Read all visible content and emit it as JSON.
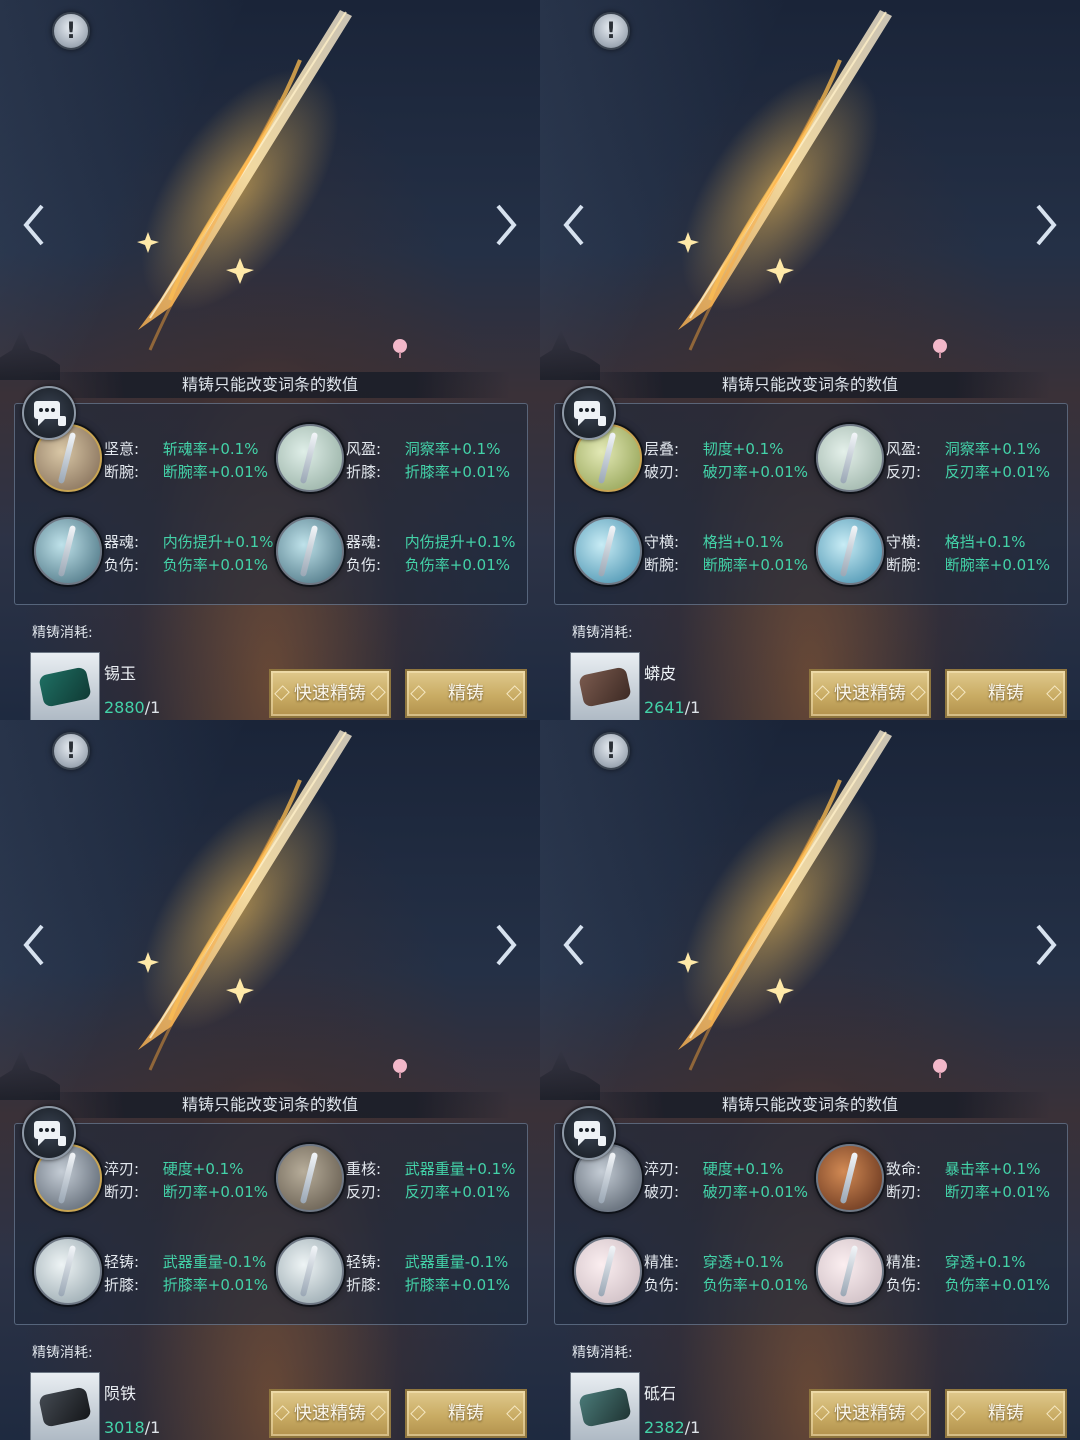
{
  "colors": {
    "value_text": "#43d2a8",
    "button_gold": "#c9ac64"
  },
  "icons": [
    "warning-icon",
    "chevron-left-icon",
    "chevron-right-icon",
    "chat-icon",
    "sword-icon"
  ],
  "panels": [
    {
      "notice": "精铸只能改变词条的数值",
      "slots": [
        {
          "lines": [
            {
              "label": "坚意:",
              "value": "斩魂率+0.1%"
            },
            {
              "label": "断腕:",
              "value": "断腕率+0.01%"
            }
          ]
        },
        {
          "lines": [
            {
              "label": "风盈:",
              "value": "洞察率+0.1%"
            },
            {
              "label": "折膝:",
              "value": "折膝率+0.01%"
            }
          ]
        },
        {
          "lines": [
            {
              "label": "器魂:",
              "value": "内伤提升+0.1%"
            },
            {
              "label": "负伤:",
              "value": "负伤率+0.01%"
            }
          ]
        },
        {
          "lines": [
            {
              "label": "器魂:",
              "value": "内伤提升+0.1%"
            },
            {
              "label": "负伤:",
              "value": "负伤率+0.01%"
            }
          ]
        }
      ],
      "cost": {
        "title": "精铸消耗:",
        "material": "锡玉",
        "have": "2880",
        "need": "/1"
      },
      "buttons": {
        "quick": "快速精铸",
        "refine": "精铸"
      }
    },
    {
      "notice": "精铸只能改变词条的数值",
      "slots": [
        {
          "lines": [
            {
              "label": "层叠:",
              "value": "韧度+0.1%"
            },
            {
              "label": "破刃:",
              "value": "破刃率+0.01%"
            }
          ]
        },
        {
          "lines": [
            {
              "label": "风盈:",
              "value": "洞察率+0.1%"
            },
            {
              "label": "反刃:",
              "value": "反刃率+0.01%"
            }
          ]
        },
        {
          "lines": [
            {
              "label": "守横:",
              "value": "格挡+0.1%"
            },
            {
              "label": "断腕:",
              "value": "断腕率+0.01%"
            }
          ]
        },
        {
          "lines": [
            {
              "label": "守横:",
              "value": "格挡+0.1%"
            },
            {
              "label": "断腕:",
              "value": "断腕率+0.01%"
            }
          ]
        }
      ],
      "cost": {
        "title": "精铸消耗:",
        "material": "蟒皮",
        "have": "2641",
        "need": "/1"
      },
      "buttons": {
        "quick": "快速精铸",
        "refine": "精铸"
      }
    },
    {
      "notice": "精铸只能改变词条的数值",
      "slots": [
        {
          "lines": [
            {
              "label": "淬刃:",
              "value": "硬度+0.1%"
            },
            {
              "label": "断刃:",
              "value": "断刃率+0.01%"
            }
          ]
        },
        {
          "lines": [
            {
              "label": "重核:",
              "value": "武器重量+0.1%"
            },
            {
              "label": "反刃:",
              "value": "反刃率+0.01%"
            }
          ]
        },
        {
          "lines": [
            {
              "label": "轻铸:",
              "value": "武器重量-0.1%"
            },
            {
              "label": "折膝:",
              "value": "折膝率+0.01%"
            }
          ]
        },
        {
          "lines": [
            {
              "label": "轻铸:",
              "value": "武器重量-0.1%"
            },
            {
              "label": "折膝:",
              "value": "折膝率+0.01%"
            }
          ]
        }
      ],
      "cost": {
        "title": "精铸消耗:",
        "material": "陨铁",
        "have": "3018",
        "need": "/1"
      },
      "buttons": {
        "quick": "快速精铸",
        "refine": "精铸"
      }
    },
    {
      "notice": "精铸只能改变词条的数值",
      "slots": [
        {
          "lines": [
            {
              "label": "淬刃:",
              "value": "硬度+0.1%"
            },
            {
              "label": "破刃:",
              "value": "破刃率+0.01%"
            }
          ]
        },
        {
          "lines": [
            {
              "label": "致命:",
              "value": "暴击率+0.1%"
            },
            {
              "label": "断刃:",
              "value": "断刃率+0.01%"
            }
          ]
        },
        {
          "lines": [
            {
              "label": "精准:",
              "value": "穿透+0.1%"
            },
            {
              "label": "负伤:",
              "value": "负伤率+0.01%"
            }
          ]
        },
        {
          "lines": [
            {
              "label": "精准:",
              "value": "穿透+0.1%"
            },
            {
              "label": "负伤:",
              "value": "负伤率+0.01%"
            }
          ]
        }
      ],
      "cost": {
        "title": "精铸消耗:",
        "material": "砥石",
        "have": "2382",
        "need": "/1"
      },
      "buttons": {
        "quick": "快速精铸",
        "refine": "精铸"
      }
    }
  ]
}
